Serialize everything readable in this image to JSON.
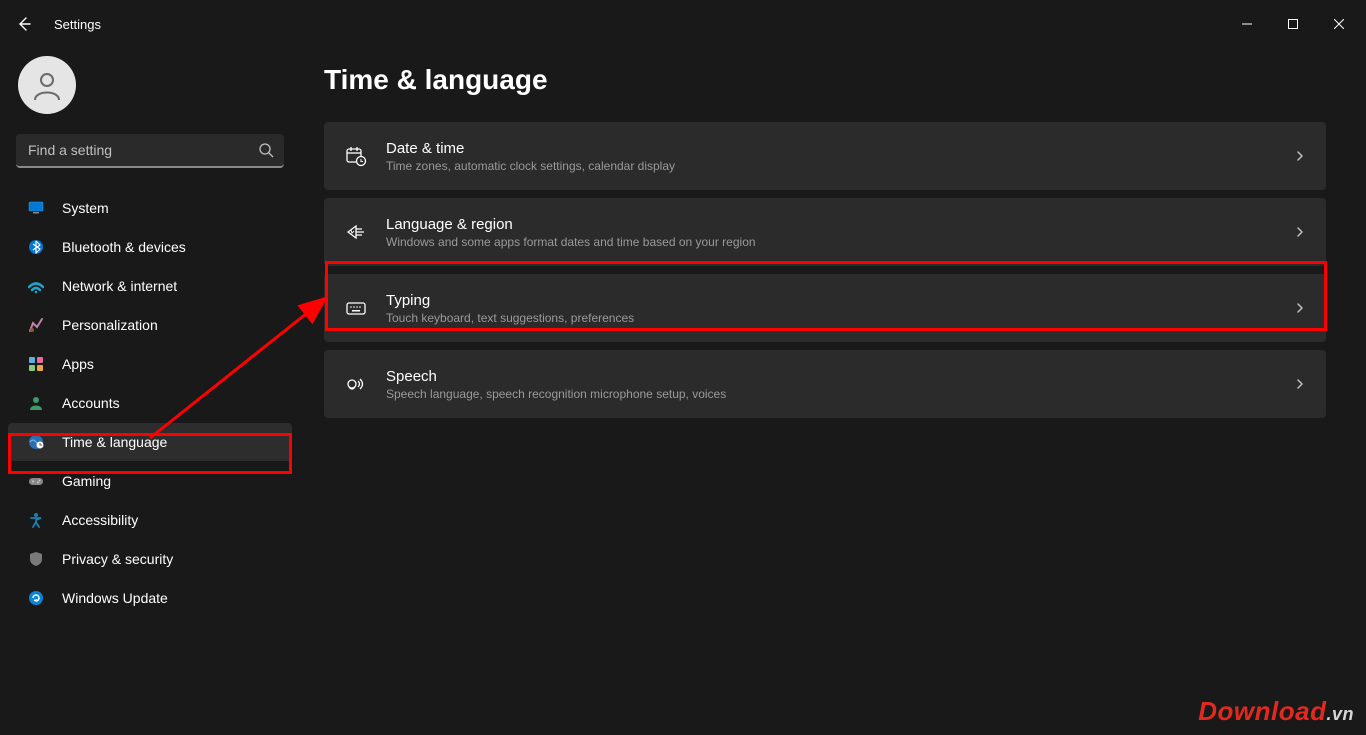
{
  "titlebar": {
    "title": "Settings"
  },
  "search": {
    "placeholder": "Find a setting"
  },
  "sidebar": {
    "items": [
      {
        "label": "System",
        "icon": "system"
      },
      {
        "label": "Bluetooth & devices",
        "icon": "bluetooth"
      },
      {
        "label": "Network & internet",
        "icon": "network"
      },
      {
        "label": "Personalization",
        "icon": "personalization"
      },
      {
        "label": "Apps",
        "icon": "apps"
      },
      {
        "label": "Accounts",
        "icon": "accounts"
      },
      {
        "label": "Time & language",
        "icon": "time",
        "selected": true
      },
      {
        "label": "Gaming",
        "icon": "gaming"
      },
      {
        "label": "Accessibility",
        "icon": "accessibility"
      },
      {
        "label": "Privacy & security",
        "icon": "privacy"
      },
      {
        "label": "Windows Update",
        "icon": "update"
      }
    ]
  },
  "main": {
    "title": "Time & language",
    "cards": [
      {
        "title": "Date & time",
        "sub": "Time zones, automatic clock settings, calendar display",
        "icon": "datetime"
      },
      {
        "title": "Language & region",
        "sub": "Windows and some apps format dates and time based on your region",
        "icon": "region"
      },
      {
        "title": "Typing",
        "sub": "Touch keyboard, text suggestions, preferences",
        "icon": "typing"
      },
      {
        "title": "Speech",
        "sub": "Speech language, speech recognition microphone setup, voices",
        "icon": "speech"
      }
    ]
  },
  "watermark": {
    "brand": "Download",
    "tld": ".vn"
  },
  "annotations": {
    "highlight_nav_index": 6,
    "highlight_card_index": 2,
    "arrow": true
  }
}
